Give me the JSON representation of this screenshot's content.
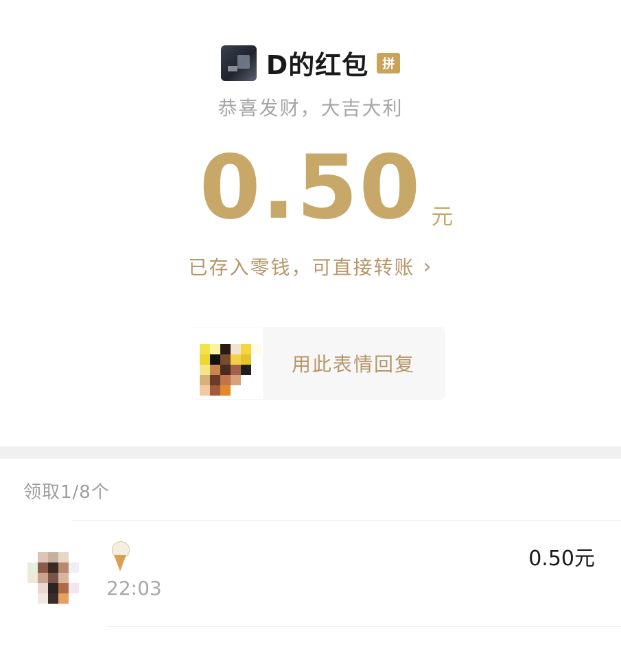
{
  "header": {
    "sender_name": "D的红包",
    "group_badge": "拼",
    "greeting": "恭喜发财，大吉大利"
  },
  "amount": {
    "value": "0.50",
    "unit": "元"
  },
  "saved_link": {
    "text": "已存入零钱，可直接转账",
    "chevron": "›"
  },
  "sticker_reply": {
    "label": "用此表情回复",
    "icon": "sticker-thumbnail"
  },
  "claims": {
    "summary": "领取1/8个",
    "items": [
      {
        "emoji_icon": "ice-cream-icon",
        "time": "22:03",
        "amount": "0.50元"
      }
    ]
  },
  "colors": {
    "gold": "#c8a869",
    "gold_text": "#b7966a",
    "badge": "#c9a35a",
    "gray_text": "#a6a6a6",
    "divider_band": "#f0f0f0"
  }
}
